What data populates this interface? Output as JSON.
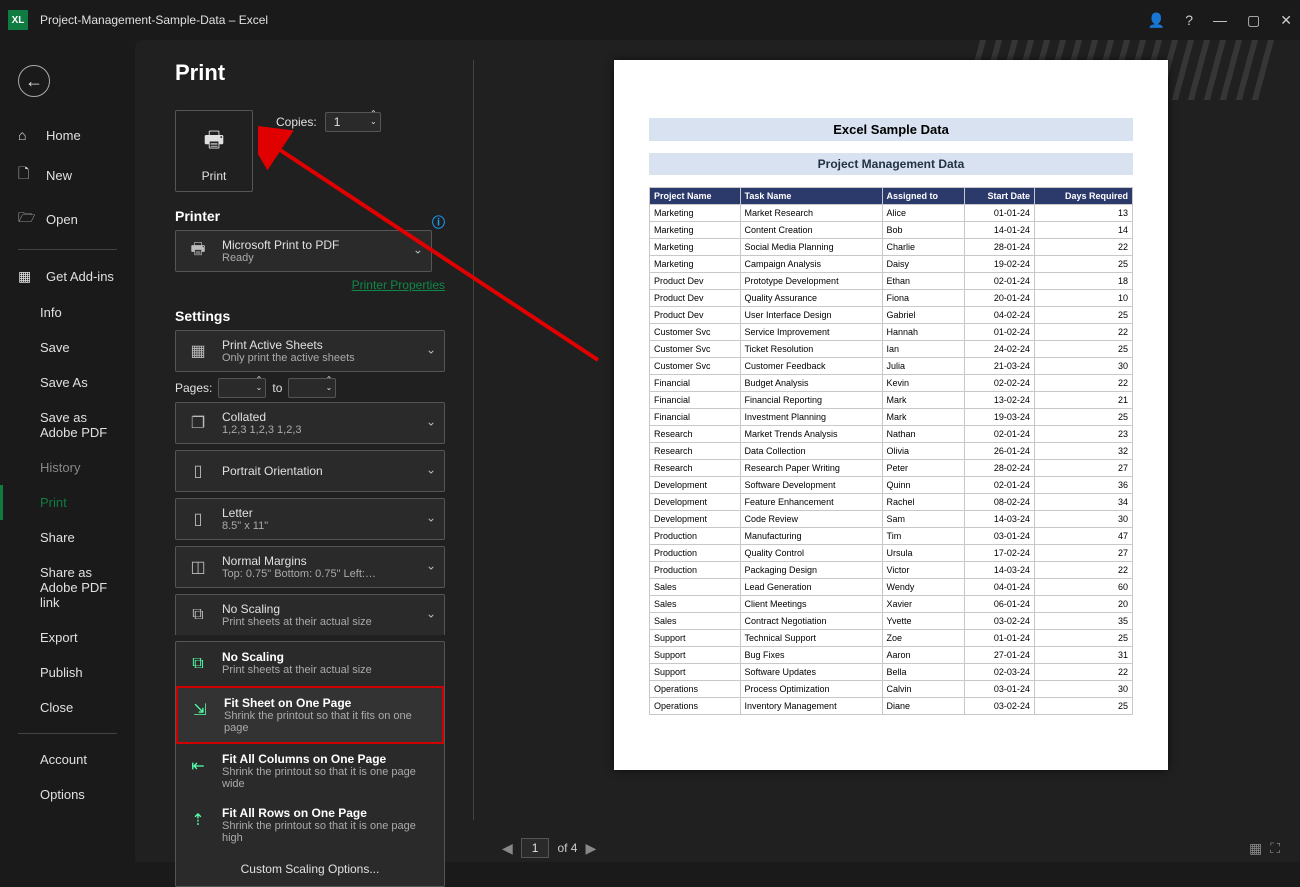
{
  "titlebar": {
    "app": "XL",
    "filename": "Project-Management-Sample-Data  –  Excel"
  },
  "sidebar": {
    "back_tooltip": "Back",
    "home": "Home",
    "new": "New",
    "open": "Open",
    "get_addins": "Get Add-ins",
    "info": "Info",
    "save": "Save",
    "save_as": "Save As",
    "save_adobe": "Save as Adobe PDF",
    "history": "History",
    "print": "Print",
    "share": "Share",
    "share_adobe": "Share as Adobe PDF link",
    "export": "Export",
    "publish": "Publish",
    "close": "Close",
    "account": "Account",
    "options": "Options"
  },
  "print_panel": {
    "page_title": "Print",
    "print_button": "Print",
    "copies_label": "Copies:",
    "copies_value": "1",
    "printer_section": "Printer",
    "printer_name": "Microsoft Print to PDF",
    "printer_status": "Ready",
    "printer_props_link": "Printer Properties",
    "settings_section": "Settings",
    "print_active_t": "Print Active Sheets",
    "print_active_d": "Only print the active sheets",
    "pages_label": "Pages:",
    "pages_to": "to",
    "collated_t": "Collated",
    "collated_d": "1,2,3    1,2,3    1,2,3",
    "orient_t": "Portrait Orientation",
    "paper_t": "Letter",
    "paper_d": "8.5\" x 11\"",
    "margins_t": "Normal Margins",
    "margins_d": "Top: 0.75\" Bottom: 0.75\" Left:…",
    "scaling_sel_t": "No Scaling",
    "scaling_sel_d": "Print sheets at their actual size",
    "scale_opts": {
      "no_scale_t": "No Scaling",
      "no_scale_d": "Print sheets at their actual size",
      "fit_sheet_t": "Fit Sheet on One Page",
      "fit_sheet_d": "Shrink the printout so that it fits on one page",
      "fit_cols_t": "Fit All Columns on One Page",
      "fit_cols_d": "Shrink the printout so that it is one page wide",
      "fit_rows_t": "Fit All Rows on One Page",
      "fit_rows_d": "Shrink the printout so that it is one page high",
      "custom": "Custom Scaling Options..."
    }
  },
  "preview": {
    "title1": "Excel Sample Data",
    "title2": "Project Management Data",
    "headers": [
      "Project Name",
      "Task Name",
      "Assigned to",
      "Start Date",
      "Days Required"
    ],
    "rows": [
      [
        "Marketing",
        "Market Research",
        "Alice",
        "01-01-24",
        "13"
      ],
      [
        "Marketing",
        "Content Creation",
        "Bob",
        "14-01-24",
        "14"
      ],
      [
        "Marketing",
        "Social Media Planning",
        "Charlie",
        "28-01-24",
        "22"
      ],
      [
        "Marketing",
        "Campaign Analysis",
        "Daisy",
        "19-02-24",
        "25"
      ],
      [
        "Product Dev",
        "Prototype Development",
        "Ethan",
        "02-01-24",
        "18"
      ],
      [
        "Product Dev",
        "Quality Assurance",
        "Fiona",
        "20-01-24",
        "10"
      ],
      [
        "Product Dev",
        "User Interface Design",
        "Gabriel",
        "04-02-24",
        "25"
      ],
      [
        "Customer Svc",
        "Service Improvement",
        "Hannah",
        "01-02-24",
        "22"
      ],
      [
        "Customer Svc",
        "Ticket Resolution",
        "Ian",
        "24-02-24",
        "25"
      ],
      [
        "Customer Svc",
        "Customer Feedback",
        "Julia",
        "21-03-24",
        "30"
      ],
      [
        "Financial",
        "Budget Analysis",
        "Kevin",
        "02-02-24",
        "22"
      ],
      [
        "Financial",
        "Financial Reporting",
        "Mark",
        "13-02-24",
        "21"
      ],
      [
        "Financial",
        "Investment Planning",
        "Mark",
        "19-03-24",
        "25"
      ],
      [
        "Research",
        "Market Trends Analysis",
        "Nathan",
        "02-01-24",
        "23"
      ],
      [
        "Research",
        "Data Collection",
        "Olivia",
        "26-01-24",
        "32"
      ],
      [
        "Research",
        "Research Paper Writing",
        "Peter",
        "28-02-24",
        "27"
      ],
      [
        "Development",
        "Software Development",
        "Quinn",
        "02-01-24",
        "36"
      ],
      [
        "Development",
        "Feature Enhancement",
        "Rachel",
        "08-02-24",
        "34"
      ],
      [
        "Development",
        "Code Review",
        "Sam",
        "14-03-24",
        "30"
      ],
      [
        "Production",
        "Manufacturing",
        "Tim",
        "03-01-24",
        "47"
      ],
      [
        "Production",
        "Quality Control",
        "Ursula",
        "17-02-24",
        "27"
      ],
      [
        "Production",
        "Packaging Design",
        "Victor",
        "14-03-24",
        "22"
      ],
      [
        "Sales",
        "Lead Generation",
        "Wendy",
        "04-01-24",
        "60"
      ],
      [
        "Sales",
        "Client Meetings",
        "Xavier",
        "06-01-24",
        "20"
      ],
      [
        "Sales",
        "Contract Negotiation",
        "Yvette",
        "03-02-24",
        "35"
      ],
      [
        "Support",
        "Technical Support",
        "Zoe",
        "01-01-24",
        "25"
      ],
      [
        "Support",
        "Bug Fixes",
        "Aaron",
        "27-01-24",
        "31"
      ],
      [
        "Support",
        "Software Updates",
        "Bella",
        "02-03-24",
        "22"
      ],
      [
        "Operations",
        "Process Optimization",
        "Calvin",
        "03-01-24",
        "30"
      ],
      [
        "Operations",
        "Inventory Management",
        "Diane",
        "03-02-24",
        "25"
      ]
    ]
  },
  "page_nav": {
    "current": "1",
    "total_label": "of 4"
  }
}
